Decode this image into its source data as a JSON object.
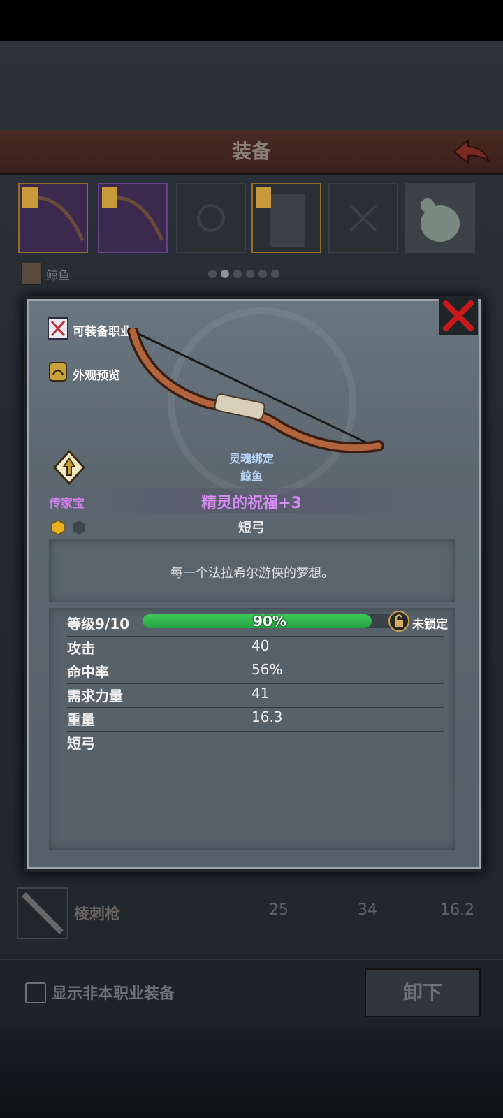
{
  "header": {
    "title": "装备"
  },
  "owner": {
    "name": "鲸鱼"
  },
  "pager": {
    "count": 6,
    "active": 1
  },
  "list_item": {
    "name": "棱刺枪",
    "values": [
      "25",
      "34",
      "16.2"
    ]
  },
  "footer": {
    "checkbox_label": "显示非本职业装备",
    "unequip_label": "卸下"
  },
  "dialog": {
    "class_label": "可装备职业",
    "preview_label": "外观预览",
    "soulbound_label": "灵魂绑定",
    "soulbound_owner": "鲸鱼",
    "rarity": "传家宝",
    "item_name": "精灵的祝福+3",
    "item_type": "短弓",
    "description": "每一个法拉希尔游侠的梦想。",
    "level": {
      "label": "等级9/10",
      "progress_percent": 90,
      "progress_text": "90%",
      "lock_label": "未锁定"
    },
    "stats": [
      {
        "label": "攻击",
        "value": "40"
      },
      {
        "label": "命中率",
        "value": "56%"
      },
      {
        "label": "需求力量",
        "value": "41"
      },
      {
        "label": "重量",
        "value": "16.3"
      },
      {
        "label": "短弓",
        "value": ""
      }
    ]
  },
  "colors": {
    "rarity": "#d27ef0",
    "progress": "#2fb24c",
    "soulbound": "#b8d4f5"
  }
}
